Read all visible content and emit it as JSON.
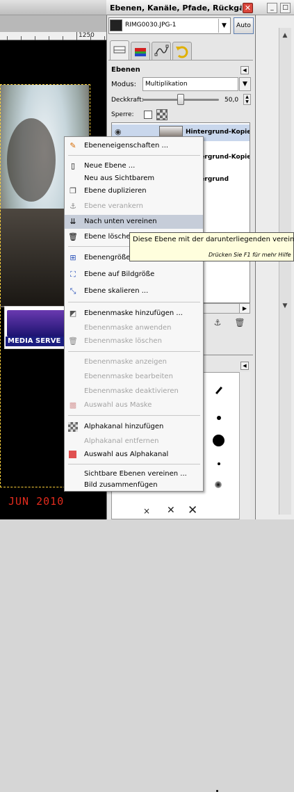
{
  "image_window": {
    "ruler_label": "1250",
    "logo_text": "MEDIA SERVE",
    "date_stamp": "JUN 2010"
  },
  "dock": {
    "title": "Ebenen, Kanäle, Pfade, Rückgäng...",
    "close_glyph": "✕",
    "image_select": "RIMG0030.JPG-1",
    "auto_label": "Auto",
    "tabs": [
      {
        "icon": "layers-tab-icon"
      },
      {
        "icon": "channels-tab-icon"
      },
      {
        "icon": "paths-tab-icon"
      },
      {
        "icon": "undo-tab-icon"
      }
    ],
    "panel_title": "Ebenen",
    "mode_label": "Modus:",
    "mode_value": "Multiplikation",
    "opacity_label": "Deckkraft:",
    "opacity_value": "50,0",
    "opacity_fraction": 0.5,
    "lock_label": "Sperre:",
    "layers": [
      {
        "name": "Hintergrund-Kopie",
        "selected": true
      },
      {
        "name": "Hintergrund-Kopie",
        "selected": false
      },
      {
        "name": "Hintergrund",
        "selected": false
      }
    ]
  },
  "context_menu": {
    "items": [
      {
        "label": "Ebeneneigenschaften ...",
        "icon": "edit-icon",
        "enabled": true
      },
      {
        "label": "Neue Ebene ...",
        "icon": "new-layer-icon",
        "enabled": true
      },
      {
        "label": "Neu aus Sichtbarem",
        "icon": "",
        "enabled": true
      },
      {
        "label": "Ebene duplizieren",
        "icon": "duplicate-icon",
        "enabled": true
      },
      {
        "label": "Ebene verankern",
        "icon": "anchor-icon",
        "enabled": false
      },
      {
        "label": "Nach unten vereinen",
        "icon": "merge-down-icon",
        "enabled": true,
        "highlighted": true
      },
      {
        "label": "Ebene löschen",
        "icon": "trash-icon",
        "enabled": true
      },
      {
        "label": "Ebenengröße ...",
        "icon": "layer-size-icon",
        "enabled": true
      },
      {
        "label": "Ebene auf Bildgröße",
        "icon": "fit-image-icon",
        "enabled": true
      },
      {
        "label": "Ebene skalieren ...",
        "icon": "scale-icon",
        "enabled": true
      },
      {
        "label": "Ebenenmaske hinzufügen ...",
        "icon": "add-mask-icon",
        "enabled": true
      },
      {
        "label": "Ebenenmaske anwenden",
        "icon": "",
        "enabled": false
      },
      {
        "label": "Ebenenmaske löschen",
        "icon": "trash-icon",
        "enabled": false
      },
      {
        "label": "Ebenenmaske anzeigen",
        "icon": "",
        "enabled": false
      },
      {
        "label": "Ebenenmaske bearbeiten",
        "icon": "",
        "enabled": false
      },
      {
        "label": "Ebenenmaske deaktivieren",
        "icon": "",
        "enabled": false
      },
      {
        "label": "Auswahl aus Maske",
        "icon": "mask-selection-icon",
        "enabled": false
      },
      {
        "label": "Alphakanal hinzufügen",
        "icon": "alpha-icon",
        "enabled": true
      },
      {
        "label": "Alphakanal entfernen",
        "icon": "",
        "enabled": false
      },
      {
        "label": "Auswahl aus Alphakanal",
        "icon": "alpha-selection-icon",
        "enabled": true
      },
      {
        "label": "Sichtbare Ebenen vereinen ...",
        "icon": "",
        "enabled": true
      },
      {
        "label": "Bild zusammenfügen",
        "icon": "",
        "enabled": true
      }
    ]
  },
  "tooltip": {
    "text": "Diese Ebene mit der darunterliegenden vereinen",
    "hint": "Drücken Sie F1 für mehr Hilfe"
  },
  "colors": {
    "menu_highlight": "#c6cdd9",
    "tooltip_bg": "#fffedd",
    "date_stamp": "#e22b1d",
    "selection_border": "#ffd23a"
  }
}
